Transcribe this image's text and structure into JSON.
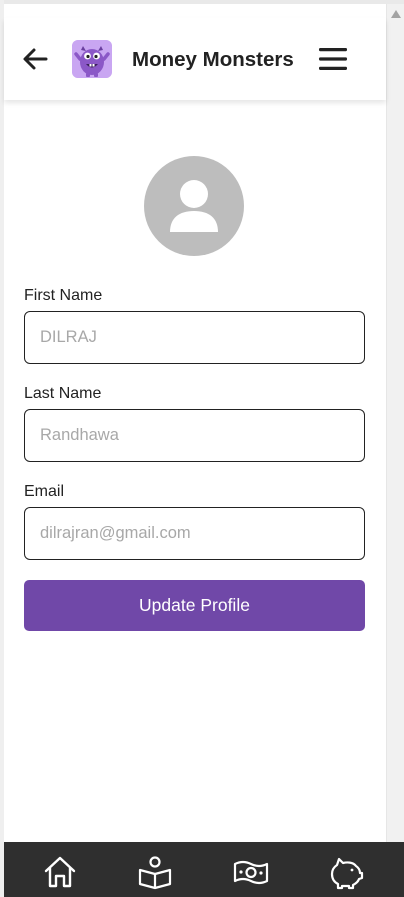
{
  "header": {
    "back_icon": "arrow-left-icon",
    "logo_icon": "purple-monster-logo",
    "title": "Money Monsters",
    "menu_icon": "hamburger-menu-icon"
  },
  "profile": {
    "avatar_icon": "user-silhouette-icon",
    "fields": [
      {
        "label": "First Name",
        "placeholder": "DILRAJ",
        "value": ""
      },
      {
        "label": "Last Name",
        "placeholder": "Randhawa",
        "value": ""
      },
      {
        "label": "Email",
        "placeholder": "dilrajran@gmail.com",
        "value": ""
      }
    ],
    "submit_label": "Update Profile"
  },
  "bottom_nav": {
    "items": [
      {
        "icon": "home-icon"
      },
      {
        "icon": "open-book-learn-icon"
      },
      {
        "icon": "money-bill-icon"
      },
      {
        "icon": "piggy-bank-icon"
      }
    ]
  },
  "colors": {
    "accent": "#7048a8",
    "nav_background": "#2f2f2f",
    "avatar_background": "#bdbdbd",
    "logo_background": "#c9a6f2"
  }
}
